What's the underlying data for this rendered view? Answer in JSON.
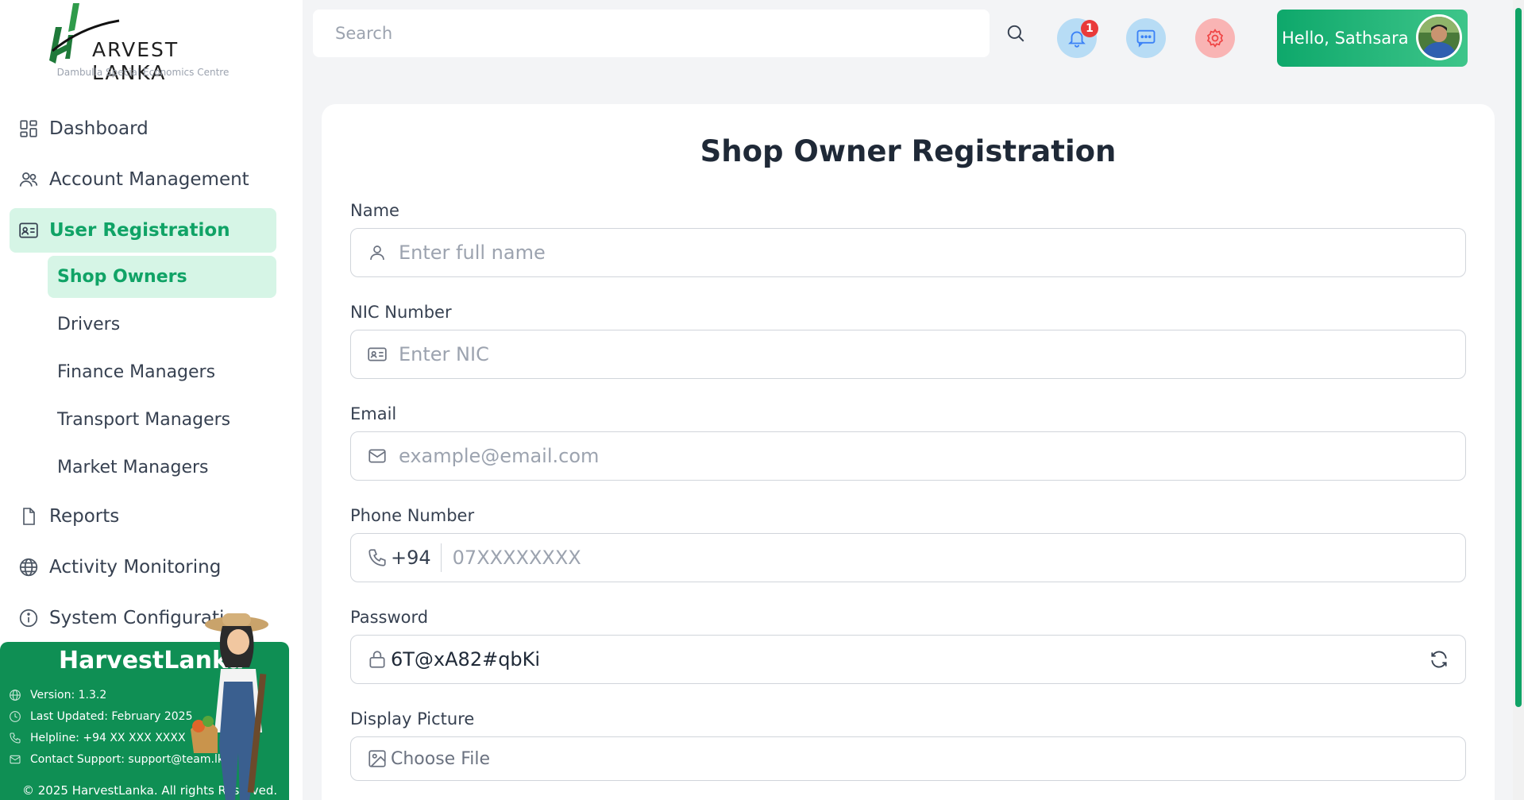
{
  "brand": {
    "name": "ARVEST LANKA",
    "subtitle": "Dambulla Special Economics Centre",
    "accent": "#10a366"
  },
  "sidebar": {
    "items": [
      {
        "label": "Dashboard",
        "icon": "dashboard-icon"
      },
      {
        "label": "Account Management",
        "icon": "users-icon"
      },
      {
        "label": "User Registration",
        "icon": "id-card-icon",
        "active": true
      }
    ],
    "sub_items": [
      {
        "label": "Shop Owners",
        "active": true
      },
      {
        "label": "Drivers"
      },
      {
        "label": "Finance Managers"
      },
      {
        "label": "Transport Managers"
      },
      {
        "label": "Market Managers"
      }
    ],
    "items2": [
      {
        "label": "Reports",
        "icon": "file-icon"
      },
      {
        "label": "Activity Monitoring",
        "icon": "globe-icon"
      },
      {
        "label": "System Configuration",
        "icon": "info-icon"
      }
    ]
  },
  "promo": {
    "title": "HarvestLanka",
    "version": "Version: 1.3.2",
    "updated": "Last Updated: February 2025",
    "helpline": "Helpline: +94 XX XXX XXXX",
    "support": "Contact Support: support@team.lk",
    "copyright": "© 2025 HarvestLanka. All rights Reserved."
  },
  "header": {
    "search_placeholder": "Search",
    "notification_count": "1",
    "greeting": "Hello, Sathsara"
  },
  "form": {
    "title": "Shop Owner Registration",
    "name_label": "Name",
    "name_placeholder": "Enter full name",
    "nic_label": "NIC Number",
    "nic_placeholder": "Enter NIC",
    "email_label": "Email",
    "email_placeholder": "example@email.com",
    "phone_label": "Phone Number",
    "phone_prefix": "+94",
    "phone_placeholder": "07XXXXXXXX",
    "password_label": "Password",
    "password_value": "6T@xA82#qbKi",
    "picture_label": "Display Picture",
    "picture_text": "Choose File"
  }
}
